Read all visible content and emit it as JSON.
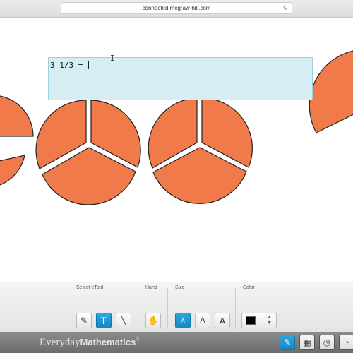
{
  "browser": {
    "url": "connected.mcgraw-hill.com",
    "reload_icon": "reload-icon"
  },
  "workspace": {
    "text_box": {
      "content": "3 1/3 = "
    },
    "pieces": {
      "color": "#f07a4a",
      "stroke": "#222222",
      "fraction_denominator": 3
    }
  },
  "toolbar": {
    "select_etool_label": "Select eTool",
    "hand_label": "Hand",
    "size_label": "Size",
    "color_label": "Color",
    "tools": [
      {
        "name": "pencil",
        "icon": "pencil-icon",
        "glyph": "✎"
      },
      {
        "name": "text",
        "icon": "text-tool-icon",
        "glyph": "T"
      },
      {
        "name": "line",
        "icon": "line-icon",
        "glyph": "╲"
      }
    ],
    "hand_glyph": "✋",
    "sizes": [
      "A",
      "A",
      "A"
    ],
    "active_size_index": 0,
    "active_tool_index": 1,
    "current_color": "#000000",
    "select_arrows": "▲▼"
  },
  "footer": {
    "brand_regular": "Everyday",
    "brand_bold": "Mathematics",
    "brand_mark": "®",
    "buttons": [
      {
        "icon": "notepad-icon",
        "glyph": "✎"
      },
      {
        "icon": "calculator-icon",
        "glyph": "▦"
      },
      {
        "icon": "timer-icon",
        "glyph": "◷"
      },
      {
        "icon": "stopwatch-icon",
        "glyph": "◔"
      }
    ]
  },
  "accent_color": "#1a93d0"
}
